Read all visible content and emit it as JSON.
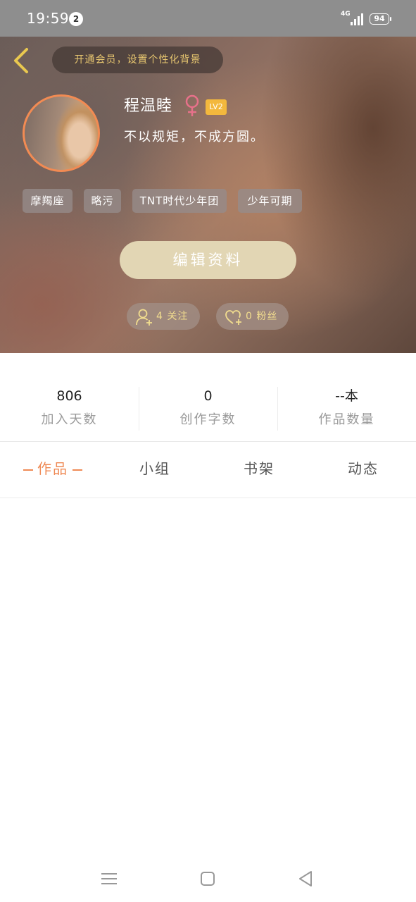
{
  "status_bar": {
    "time": "19:59",
    "notification_count": "2",
    "network": "4G",
    "battery": "94"
  },
  "header": {
    "vip_banner": "开通会员，设置个性化背景",
    "nickname": "程温睦",
    "gender_icon": "female-symbol",
    "level": "LV2",
    "signature": "不以规矩，不成方圆。",
    "tags": [
      "摩羯座",
      "略污",
      "TNT时代少年团",
      "少年可期"
    ],
    "edit_button": "编辑资料",
    "following": {
      "icon": "user-add-icon",
      "label": "4 关注"
    },
    "followers": {
      "icon": "heart-add-icon",
      "label": "0 粉丝"
    }
  },
  "stats": [
    {
      "value": "806",
      "label": "加入天数"
    },
    {
      "value": "0",
      "label": "创作字数"
    },
    {
      "value": "--本",
      "label": "作品数量"
    }
  ],
  "tabs": [
    {
      "label": "作品",
      "active": true
    },
    {
      "label": "小组",
      "active": false
    },
    {
      "label": "书架",
      "active": false
    },
    {
      "label": "动态",
      "active": false
    }
  ],
  "nav": [
    "menu-icon",
    "home-square-icon",
    "back-triangle-icon"
  ],
  "colors": {
    "accent": "#ef8a55",
    "avatar_ring": "#f28b53",
    "banner_text": "#e8c770",
    "level_badge": "#f3b83d",
    "edit_button": "#e2d6b4",
    "gender": "#e7718a"
  }
}
